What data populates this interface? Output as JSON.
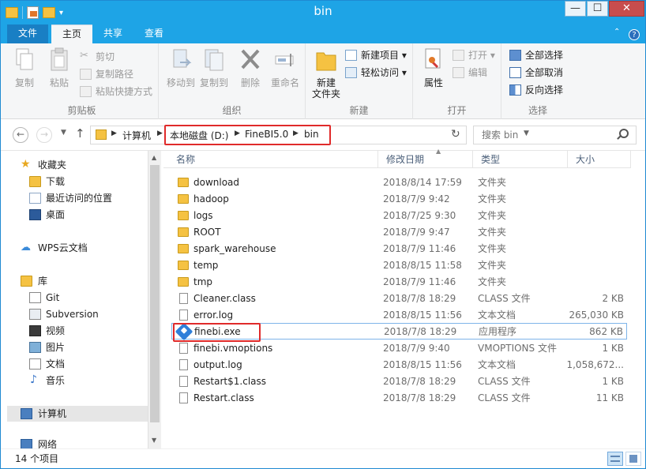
{
  "window": {
    "title": "bin",
    "controls": {
      "minimize": "—",
      "maximize": "☐",
      "close": "✕"
    }
  },
  "ribbon_tabs": [
    "文件",
    "主页",
    "共享",
    "查看"
  ],
  "ribbon": {
    "clipboard": {
      "label": "剪贴板",
      "copy": "复制",
      "paste": "粘贴",
      "cut": "剪切",
      "copy_path": "复制路径",
      "paste_shortcut": "粘贴快捷方式"
    },
    "organize": {
      "label": "组织",
      "move_to": "移动到",
      "copy_to": "复制到",
      "delete": "删除",
      "rename": "重命名"
    },
    "new": {
      "label": "新建",
      "new_folder": "新建\n文件夹",
      "new_item": "新建项目",
      "easy_access": "轻松访问"
    },
    "open": {
      "label": "打开",
      "properties": "属性",
      "open": "打开",
      "edit": "编辑"
    },
    "select": {
      "label": "选择",
      "select_all": "全部选择",
      "select_none": "全部取消",
      "invert": "反向选择"
    }
  },
  "address": {
    "crumbs": [
      "计算机",
      "本地磁盘 (D:)",
      "FineBI5.0",
      "bin"
    ],
    "search_placeholder": "搜索 bin"
  },
  "nav_pane": {
    "favorites": {
      "label": "收藏夹",
      "items": [
        "下载",
        "最近访问的位置",
        "桌面"
      ]
    },
    "wps": "WPS云文档",
    "libraries": {
      "label": "库",
      "items": [
        "Git",
        "Subversion",
        "视频",
        "图片",
        "文档",
        "音乐"
      ]
    },
    "computer": "计算机",
    "network": "网络"
  },
  "columns": {
    "name": "名称",
    "date": "修改日期",
    "type": "类型",
    "size": "大小"
  },
  "files": [
    {
      "name": "download",
      "date": "2018/8/14 17:59",
      "type": "文件夹",
      "size": "",
      "kind": "folder"
    },
    {
      "name": "hadoop",
      "date": "2018/7/9 9:42",
      "type": "文件夹",
      "size": "",
      "kind": "folder"
    },
    {
      "name": "logs",
      "date": "2018/7/25 9:30",
      "type": "文件夹",
      "size": "",
      "kind": "folder"
    },
    {
      "name": "ROOT",
      "date": "2018/7/9 9:47",
      "type": "文件夹",
      "size": "",
      "kind": "folder"
    },
    {
      "name": "spark_warehouse",
      "date": "2018/7/9 11:46",
      "type": "文件夹",
      "size": "",
      "kind": "folder"
    },
    {
      "name": "temp",
      "date": "2018/8/15 11:58",
      "type": "文件夹",
      "size": "",
      "kind": "folder"
    },
    {
      "name": "tmp",
      "date": "2018/7/9 11:46",
      "type": "文件夹",
      "size": "",
      "kind": "folder"
    },
    {
      "name": "Cleaner.class",
      "date": "2018/7/8 18:29",
      "type": "CLASS 文件",
      "size": "2 KB",
      "kind": "file"
    },
    {
      "name": "error.log",
      "date": "2018/8/15 11:56",
      "type": "文本文档",
      "size": "265,030 KB",
      "kind": "file"
    },
    {
      "name": "finebi.exe",
      "date": "2018/7/8 18:29",
      "type": "应用程序",
      "size": "862 KB",
      "kind": "exe"
    },
    {
      "name": "finebi.vmoptions",
      "date": "2018/7/9 9:40",
      "type": "VMOPTIONS 文件",
      "size": "1 KB",
      "kind": "file"
    },
    {
      "name": "output.log",
      "date": "2018/8/15 11:56",
      "type": "文本文档",
      "size": "1,058,672...",
      "kind": "file"
    },
    {
      "name": "Restart$1.class",
      "date": "2018/7/8 18:29",
      "type": "CLASS 文件",
      "size": "1 KB",
      "kind": "file"
    },
    {
      "name": "Restart.class",
      "date": "2018/7/8 18:29",
      "type": "CLASS 文件",
      "size": "11 KB",
      "kind": "file"
    }
  ],
  "status": {
    "count": "14 个项目"
  },
  "colors": {
    "titlebar": "#1ea4e6",
    "highlight": "#e02a2a",
    "folder": "#f5c242"
  }
}
